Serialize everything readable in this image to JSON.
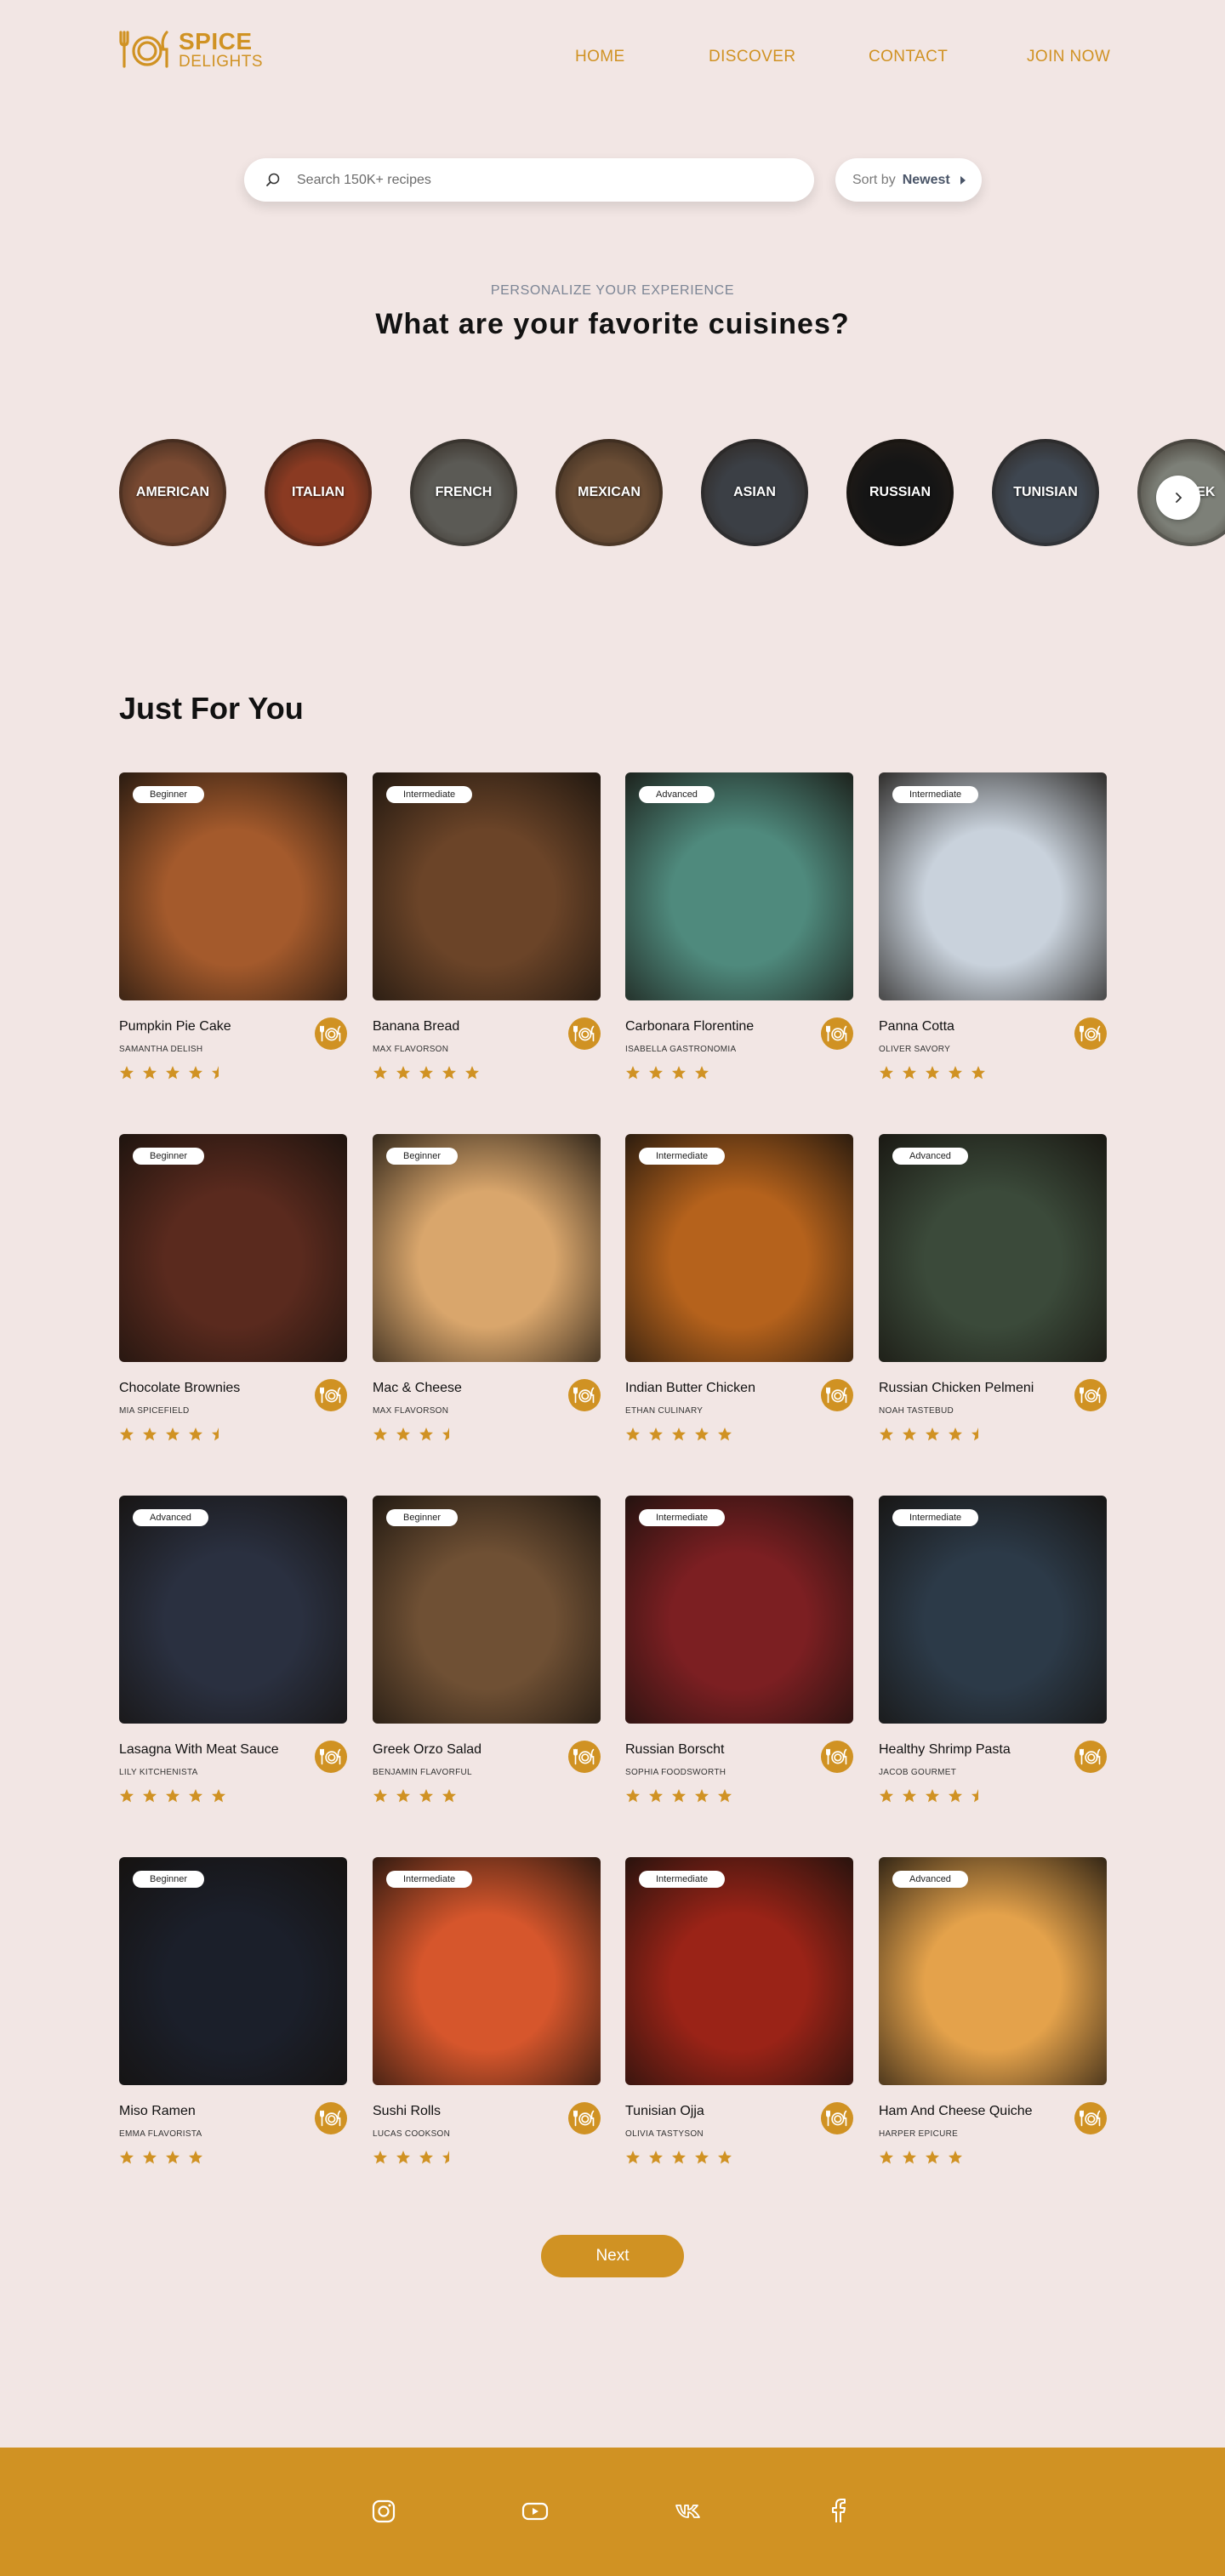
{
  "brand": {
    "line1": "SPICE",
    "line2": "DELIGHTS",
    "color": "#d09223"
  },
  "nav": [
    {
      "label": "HOME"
    },
    {
      "label": "DISCOVER"
    },
    {
      "label": "CONTACT"
    },
    {
      "label": "JOIN NOW"
    }
  ],
  "search": {
    "placeholder": "Search 150K+ recipes",
    "icon": "search-icon"
  },
  "sort": {
    "label": "Sort by",
    "value": "Newest"
  },
  "personalize": {
    "kicker": "PERSONALIZE YOUR EXPERIENCE",
    "question": "What are your favorite cuisines?"
  },
  "cuisines": [
    {
      "label": "AMERICAN",
      "color": "#7a4a32"
    },
    {
      "label": "ITALIAN",
      "color": "#8a3a22"
    },
    {
      "label": "FRENCH",
      "color": "#5b5a55"
    },
    {
      "label": "MEXICAN",
      "color": "#6a4d35"
    },
    {
      "label": "ASIAN",
      "color": "#3b3f45"
    },
    {
      "label": "RUSSIAN",
      "color": "#151515"
    },
    {
      "label": "TUNISIAN",
      "color": "#3e4650"
    },
    {
      "label": "GREEK",
      "color": "#7d8078"
    }
  ],
  "section": {
    "title": "Just For You"
  },
  "recipes": [
    {
      "title": "Pumpkin Pie Cake",
      "author": "SAMANTHA DELISH",
      "level": "Beginner",
      "rating": 4.5,
      "color": "#a45a2c"
    },
    {
      "title": "Banana Bread",
      "author": "MAX FLAVORSON",
      "level": "Intermediate",
      "rating": 5,
      "color": "#6b4428"
    },
    {
      "title": "Carbonara Florentine",
      "author": "ISABELLA GASTRONOMIA",
      "level": "Advanced",
      "rating": 4,
      "color": "#4f8a7d"
    },
    {
      "title": "Panna Cotta",
      "author": "OLIVER SAVORY",
      "level": "Intermediate",
      "rating": 5,
      "color": "#c9d2dc"
    },
    {
      "title": "Chocolate Brownies",
      "author": "MIA SPICEFIELD",
      "level": "Beginner",
      "rating": 4.5,
      "color": "#5a2a1e"
    },
    {
      "title": "Mac & Cheese",
      "author": "MAX FLAVORSON",
      "level": "Beginner",
      "rating": 3.5,
      "color": "#d9a66c"
    },
    {
      "title": "Indian Butter Chicken",
      "author": "ETHAN CULINARY",
      "level": "Intermediate",
      "rating": 5,
      "color": "#b5621c"
    },
    {
      "title": "Russian Chicken Pelmeni",
      "author": "NOAH TASTEBUD",
      "level": "Advanced",
      "rating": 4.5,
      "color": "#3b4a3a"
    },
    {
      "title": "Lasagna With Meat Sauce",
      "author": "LILY KITCHENISTA",
      "level": "Advanced",
      "rating": 5,
      "color": "#2a3040"
    },
    {
      "title": "Greek Orzo Salad",
      "author": "BENJAMIN FLAVORFUL",
      "level": "Beginner",
      "rating": 4,
      "color": "#6f5034"
    },
    {
      "title": "Russian Borscht",
      "author": "SOPHIA FOODSWORTH",
      "level": "Intermediate",
      "rating": 5,
      "color": "#7c1f22"
    },
    {
      "title": "Healthy Shrimp Pasta",
      "author": "JACOB GOURMET",
      "level": "Intermediate",
      "rating": 4.5,
      "color": "#2c3a48"
    },
    {
      "title": "Miso Ramen",
      "author": "EMMA FLAVORISTA",
      "level": "Beginner",
      "rating": 4,
      "color": "#1b1f2a"
    },
    {
      "title": "Sushi Rolls",
      "author": "LUCAS COOKSON",
      "level": "Intermediate",
      "rating": 3.5,
      "color": "#d6562c"
    },
    {
      "title": "Tunisian Ojja",
      "author": "OLIVIA TASTYSON",
      "level": "Intermediate",
      "rating": 5,
      "color": "#9a2317"
    },
    {
      "title": "Ham And Cheese Quiche",
      "author": "HARPER EPICURE",
      "level": "Advanced",
      "rating": 4,
      "color": "#e4a24b"
    }
  ],
  "pager": {
    "next_label": "Next"
  },
  "footer": {
    "social": [
      {
        "icon": "instagram-icon"
      },
      {
        "icon": "youtube-icon"
      },
      {
        "icon": "vk-icon"
      },
      {
        "icon": "facebook-icon"
      }
    ]
  }
}
